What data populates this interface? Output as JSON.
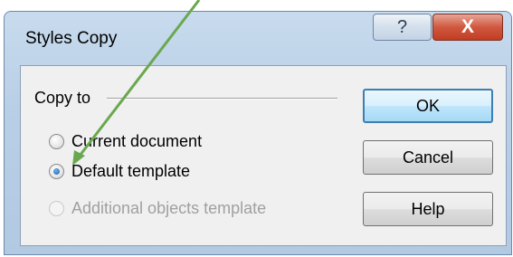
{
  "window": {
    "title": "Styles Copy",
    "help_symbol": "?",
    "close_symbol": "X"
  },
  "group": {
    "label": "Copy to",
    "options": [
      {
        "label": "Current document",
        "selected": false,
        "enabled": true
      },
      {
        "label": "Default template",
        "selected": true,
        "enabled": true
      },
      {
        "label": "Additional objects template",
        "selected": false,
        "enabled": false
      }
    ]
  },
  "buttons": {
    "ok": "OK",
    "cancel": "Cancel",
    "help": "Help"
  },
  "annotation": {
    "arrow_color": "#6aa84f"
  }
}
